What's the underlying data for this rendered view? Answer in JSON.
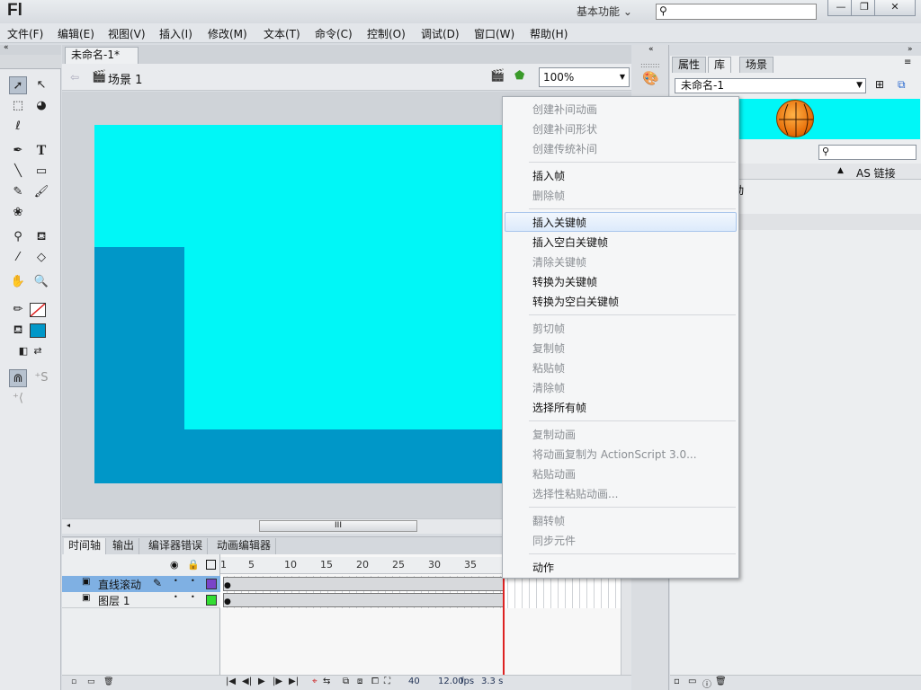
{
  "app": {
    "logo": "Fl",
    "workspace": "基本功能 ⌄"
  },
  "window_buttons": {
    "minimize": "—",
    "restore": "❐",
    "close": "✕"
  },
  "menu": [
    "文件(F)",
    "编辑(E)",
    "视图(V)",
    "插入(I)",
    "修改(M)",
    "文本(T)",
    "命令(C)",
    "控制(O)",
    "调试(D)",
    "窗口(W)",
    "帮助(H)"
  ],
  "document": {
    "tab_title": "未命名-1*",
    "tab_close": "×",
    "scene_label": "场景 1",
    "zoom": "100%"
  },
  "stage": {
    "colors": {
      "cyan": "#00f7f7",
      "blue": "#0097c8"
    }
  },
  "scrollbar_grip": "III",
  "timeline": {
    "tabs": [
      "时间轴",
      "输出",
      "编译器错误",
      "动画编辑器"
    ],
    "ruler": [
      "1",
      "5",
      "10",
      "15",
      "20",
      "25",
      "30",
      "35"
    ],
    "layers": [
      {
        "name": "直线滚动",
        "color": "#7a44c8",
        "selected": true
      },
      {
        "name": "图层 1",
        "color": "#33dd33",
        "selected": false
      }
    ],
    "status": {
      "frame": "40",
      "fps": "12.00",
      "fps_unit": "fps",
      "time": "3.3 s"
    }
  },
  "library": {
    "tabs": [
      "属性",
      "库",
      "场景"
    ],
    "active_tab": "库",
    "document": "未命名-1",
    "column_link": "AS 链接",
    "item_fragment": "动"
  },
  "context_menu": {
    "groups": [
      [
        {
          "label": "创建补间动画",
          "enabled": false
        },
        {
          "label": "创建补间形状",
          "enabled": false
        },
        {
          "label": "创建传统补间",
          "enabled": false
        }
      ],
      [
        {
          "label": "插入帧",
          "enabled": true
        },
        {
          "label": "删除帧",
          "enabled": false
        }
      ],
      [
        {
          "label": "插入关键帧",
          "enabled": true,
          "highlighted": true
        },
        {
          "label": "插入空白关键帧",
          "enabled": true
        },
        {
          "label": "清除关键帧",
          "enabled": false
        },
        {
          "label": "转换为关键帧",
          "enabled": true
        },
        {
          "label": "转换为空白关键帧",
          "enabled": true
        }
      ],
      [
        {
          "label": "剪切帧",
          "enabled": false
        },
        {
          "label": "复制帧",
          "enabled": false
        },
        {
          "label": "粘贴帧",
          "enabled": false
        },
        {
          "label": "清除帧",
          "enabled": false
        },
        {
          "label": "选择所有帧",
          "enabled": true
        }
      ],
      [
        {
          "label": "复制动画",
          "enabled": false
        },
        {
          "label": "将动画复制为 ActionScript 3.0...",
          "enabled": false
        },
        {
          "label": "粘贴动画",
          "enabled": false
        },
        {
          "label": "选择性粘贴动画...",
          "enabled": false
        }
      ],
      [
        {
          "label": "翻转帧",
          "enabled": false
        },
        {
          "label": "同步元件",
          "enabled": false
        }
      ],
      [
        {
          "label": "动作",
          "enabled": true
        }
      ]
    ]
  },
  "tools": [
    "selection-tool",
    "subselection-tool",
    "free-transform-tool",
    "3d-rotation-tool",
    "lasso-tool",
    "pen-tool",
    "text-tool",
    "line-tool",
    "rectangle-tool",
    "pencil-tool",
    "brush-tool",
    "deco-tool",
    "bone-tool",
    "paint-bucket-tool",
    "eyedropper-tool",
    "eraser-tool",
    "hand-tool",
    "zoom-tool",
    "stroke-color",
    "fill-color",
    "snap-toggle"
  ],
  "tool_colors": {
    "stroke": "none",
    "fill": "#0097c8"
  }
}
